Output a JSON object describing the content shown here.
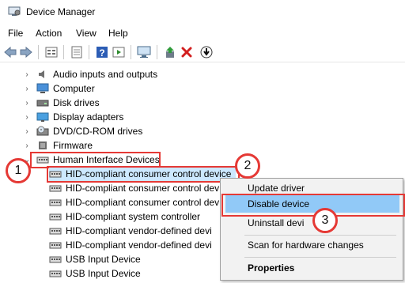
{
  "window": {
    "title": "Device Manager"
  },
  "menu": [
    "File",
    "Action",
    "View",
    "Help"
  ],
  "tree": {
    "categories": [
      {
        "label": "Audio inputs and outputs",
        "icon": "speaker-icon"
      },
      {
        "label": "Computer",
        "icon": "computer-icon"
      },
      {
        "label": "Disk drives",
        "icon": "disk-drive-icon"
      },
      {
        "label": "Display adapters",
        "icon": "display-adapter-icon"
      },
      {
        "label": "DVD/CD-ROM drives",
        "icon": "dvd-drive-icon"
      },
      {
        "label": "Firmware",
        "icon": "firmware-icon"
      },
      {
        "label": "Human Interface Devices",
        "icon": "hid-icon"
      }
    ],
    "hid_children": [
      "HID-compliant consumer control device",
      "HID-compliant consumer control dev",
      "HID-compliant consumer control dev",
      "HID-compliant system controller",
      "HID-compliant vendor-defined devi",
      "HID-compliant vendor-defined devi",
      "USB Input Device",
      "USB Input Device"
    ]
  },
  "context_menu": {
    "items": [
      "Update driver",
      "Disable device",
      "Uninstall devi",
      "Scan for hardware changes",
      "Properties"
    ],
    "selected": "Disable device"
  },
  "callouts": [
    "1",
    "2",
    "3"
  ],
  "colors": {
    "callout": "#e53935",
    "selection": "#cce8ff",
    "menu_highlight": "#91c9f7"
  }
}
